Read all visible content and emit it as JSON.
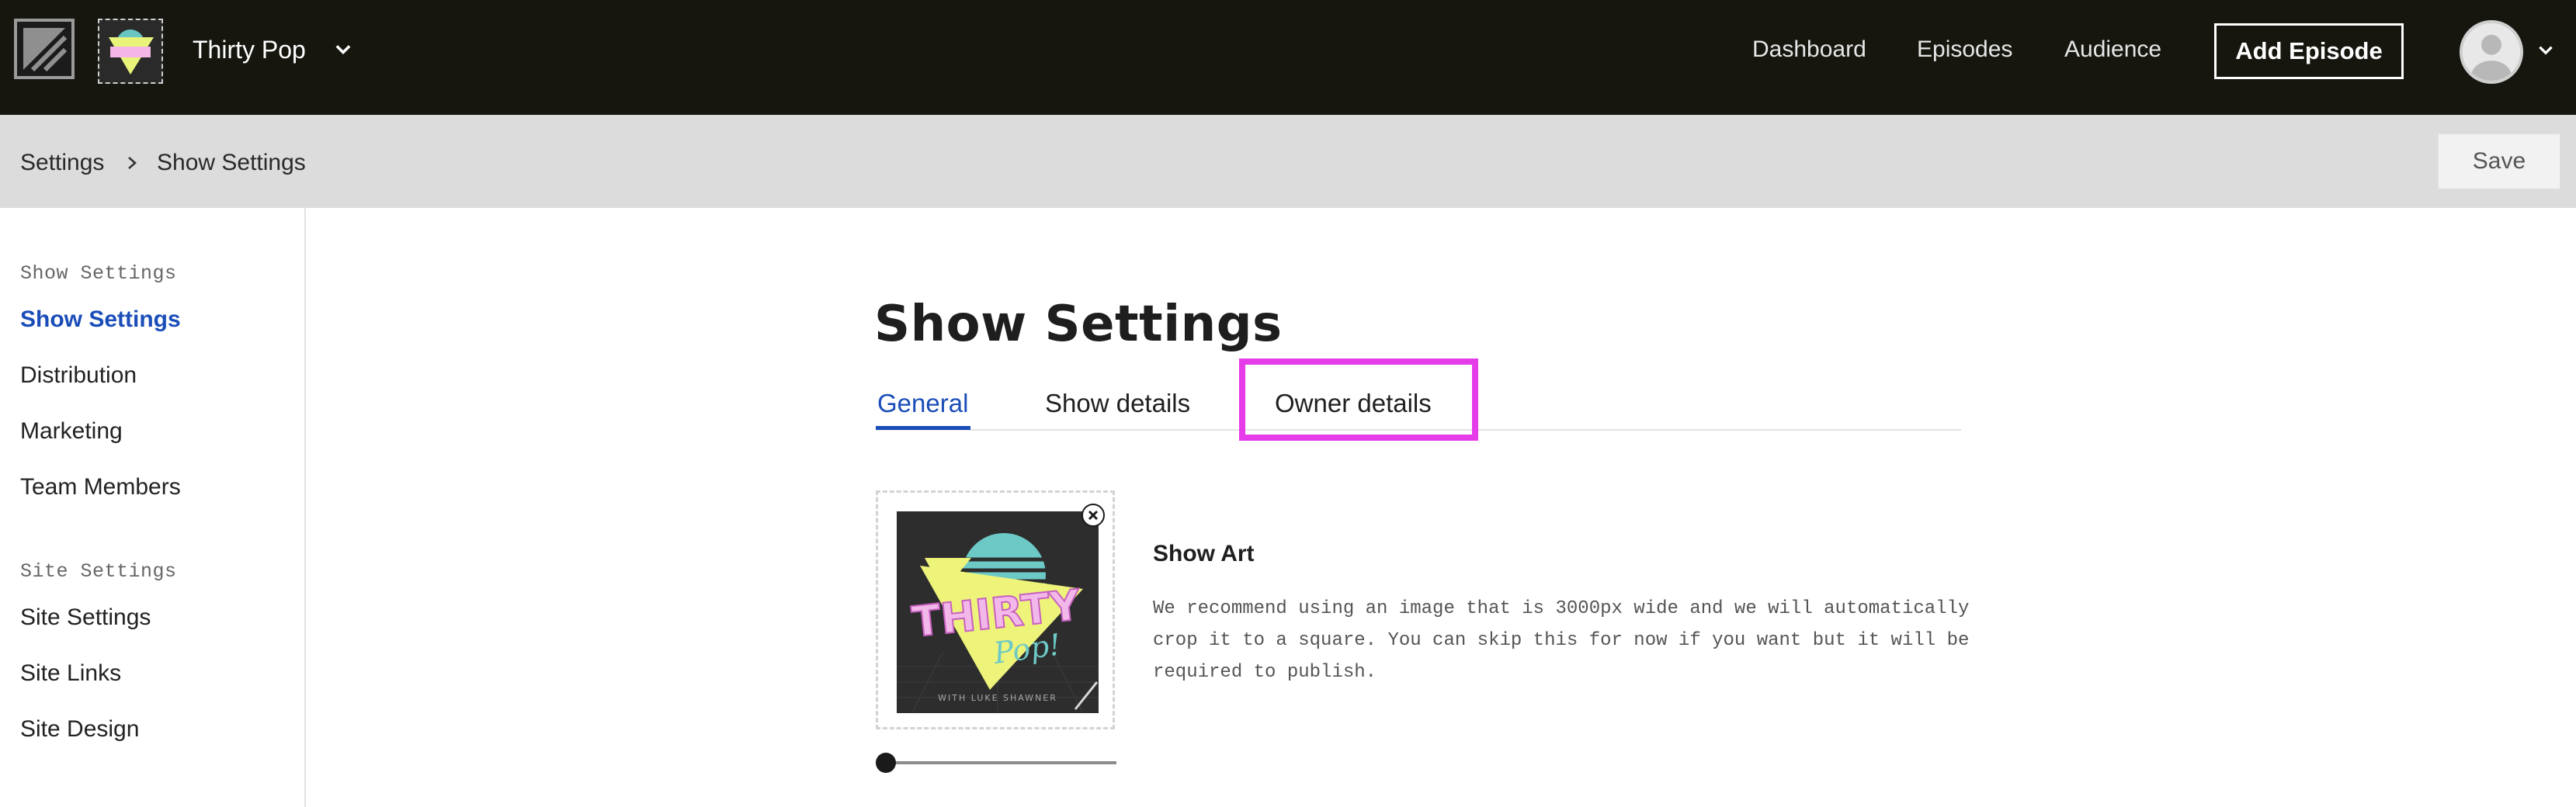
{
  "topnav": {
    "show_name": "Thirty Pop",
    "links": {
      "dashboard": "Dashboard",
      "episodes": "Episodes",
      "audience": "Audience"
    },
    "add_episode_label": "Add Episode",
    "icons": {
      "brand": "brand-logo-icon",
      "show_dropdown": "chevron-down-icon",
      "avatar": "user-avatar-icon",
      "account_dropdown": "chevron-down-icon"
    },
    "background": "#16160f"
  },
  "breadcrumb": {
    "items": [
      "Settings",
      "Show Settings"
    ],
    "separator_icon": "chevron-right-icon"
  },
  "save_label": "Save",
  "sidebar": {
    "sections": [
      {
        "heading": "Show Settings",
        "items": [
          "Show Settings",
          "Distribution",
          "Marketing",
          "Team Members"
        ]
      },
      {
        "heading": "Site Settings",
        "items": [
          "Site Settings",
          "Site Links",
          "Site Design"
        ]
      }
    ],
    "active_item": "Show Settings"
  },
  "main": {
    "title": "Show Settings",
    "tabs": [
      "General",
      "Show details",
      "Owner details"
    ],
    "active_tab": "General",
    "highlighted_tab": "Owner details",
    "show_art": {
      "title": "Show Art",
      "description": "We recommend using an image that is 3000px wide and we will automatically crop it to a square. You can skip this for now if you want but it will be required to publish.",
      "image_text": {
        "line1": "THIRTY",
        "line2": "Pop!",
        "byline": "WITH LUKE SHAWNER"
      },
      "remove_icon": "close-icon",
      "zoom_level": 0
    }
  },
  "colors": {
    "accent": "#1a4db8",
    "highlight": "#e53be8",
    "subbar": "#dcdcdc"
  }
}
